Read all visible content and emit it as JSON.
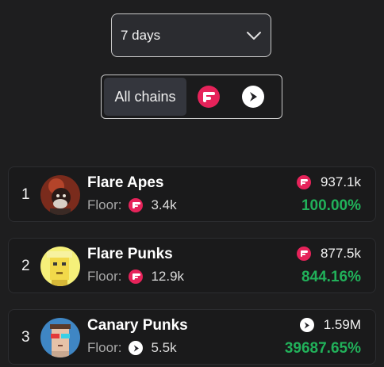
{
  "period": {
    "label": "7 days"
  },
  "chains": {
    "all_label": "All chains"
  },
  "rows": [
    {
      "rank": "1",
      "name": "Flare Apes",
      "floor_label": "Floor:",
      "floor": "3.4k",
      "volume": "937.1k",
      "change": "100.00%",
      "chain": "flare"
    },
    {
      "rank": "2",
      "name": "Flare Punks",
      "floor_label": "Floor:",
      "floor": "12.9k",
      "volume": "877.5k",
      "change": "844.16%",
      "chain": "flare"
    },
    {
      "rank": "3",
      "name": "Canary Punks",
      "floor_label": "Floor:",
      "floor": "5.5k",
      "volume": "1.59M",
      "change": "39687.65%",
      "chain": "songbird"
    }
  ],
  "colors": {
    "accent_green": "#21b15a",
    "flare": "#e6235a",
    "background": "#1e1e1f"
  },
  "icons": [
    "chevron-down-icon",
    "flare-icon",
    "songbird-icon"
  ]
}
